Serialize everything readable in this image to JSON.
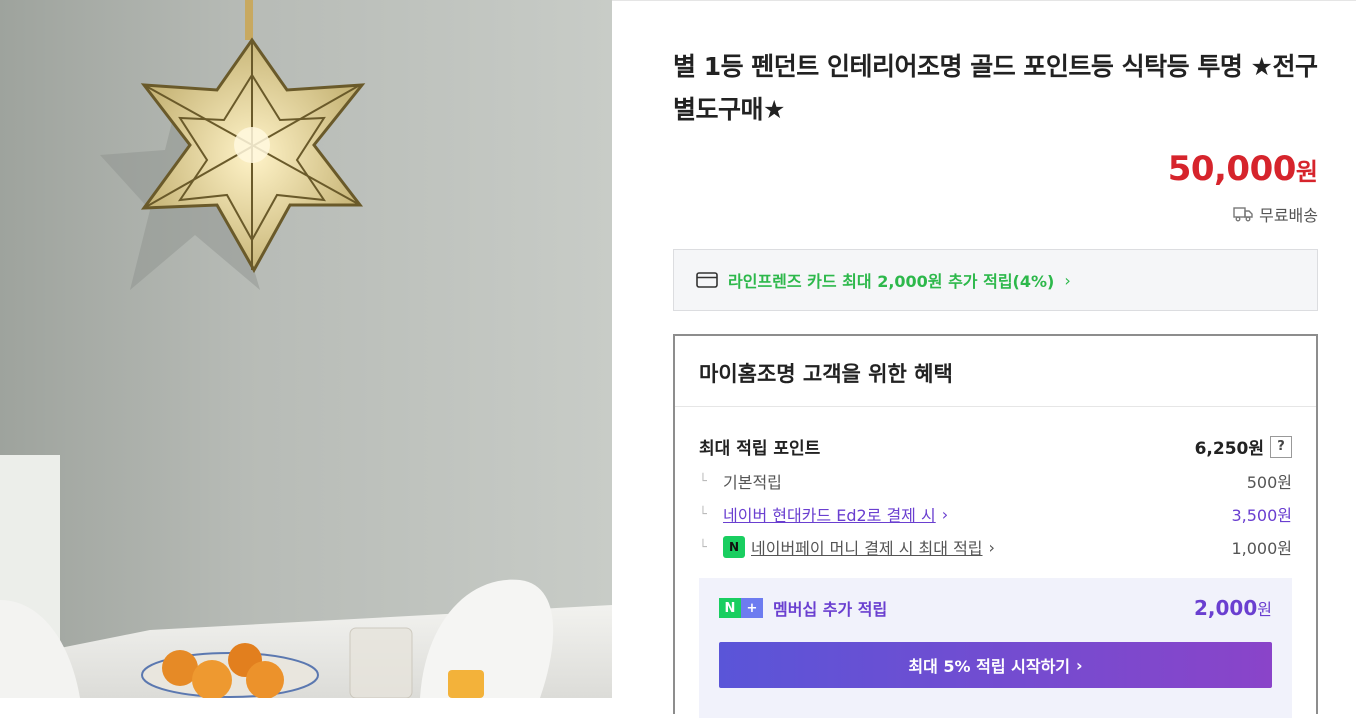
{
  "product": {
    "title": "별 1등 펜던트 인테리어조명 골드 포인트등 식탁등 투명 ★전구별도구매★",
    "price": "50,000",
    "price_unit": "원",
    "shipping": "무료배송"
  },
  "card_banner": {
    "text": "라인프렌즈 카드 최대 2,000원 추가 적립(4%)",
    "icon": "credit-card-icon"
  },
  "benefits": {
    "title": "마이홈조명 고객을 위한 혜택",
    "max_points_label": "최대 적립 포인트",
    "max_points_value": "6,250원",
    "help_label": "?",
    "items": [
      {
        "label": "기본적립",
        "value": "500원"
      },
      {
        "label": "네이버 현대카드 Ed2로 결제 시",
        "value": "3,500원"
      },
      {
        "label": "네이버페이 머니 결제 시 최대 적립",
        "value": "1,000원"
      }
    ],
    "npay_badge": "N",
    "membership": {
      "label": "멤버십 추가 적립",
      "value": "2,000",
      "unit": "원",
      "badge_n": "N",
      "badge_plus": "+",
      "cta": "최대 5% 적립 시작하기"
    }
  },
  "colors": {
    "price": "#d6242c",
    "accent_green": "#2db84b",
    "accent_purple": "#6a3fd0"
  }
}
